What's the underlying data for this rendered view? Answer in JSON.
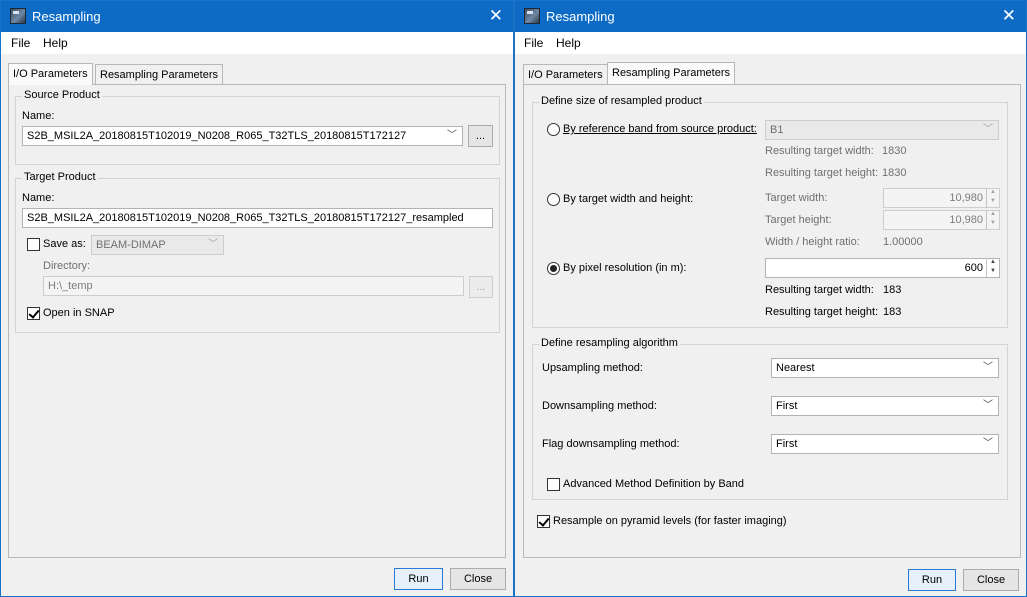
{
  "window_left": {
    "title": "Resampling",
    "menu": {
      "file": "File",
      "help": "Help"
    },
    "tabs": {
      "io": "I/O Parameters",
      "resampling": "Resampling Parameters"
    },
    "source": {
      "legend": "Source Product",
      "name_label": "Name:",
      "name_value": "S2B_MSIL2A_20180815T102019_N0208_R065_T32TLS_20180815T172127",
      "browse": "..."
    },
    "target": {
      "legend": "Target Product",
      "name_label": "Name:",
      "name_value": "S2B_MSIL2A_20180815T102019_N0208_R065_T32TLS_20180815T172127_resampled",
      "save_as_label": "Save as:",
      "save_as_checked": false,
      "format_value": "BEAM-DIMAP",
      "directory_label": "Directory:",
      "directory_value": "H:\\_temp",
      "browse": "...",
      "open_in_snap_label": "Open in SNAP",
      "open_in_snap_checked": true
    },
    "buttons": {
      "run": "Run",
      "close": "Close"
    }
  },
  "window_right": {
    "title": "Resampling",
    "menu": {
      "file": "File",
      "help": "Help"
    },
    "tabs": {
      "io": "I/O Parameters",
      "resampling": "Resampling Parameters"
    },
    "size_group": {
      "legend": "Define size of resampled product",
      "by_reference": {
        "label": "By reference band from source product:",
        "selected": false,
        "band_value": "B1",
        "result_width_label": "Resulting target width:",
        "result_width_value": "1830",
        "result_height_label": "Resulting target height:",
        "result_height_value": "1830"
      },
      "by_width_height": {
        "label": "By target width and height:",
        "selected": false,
        "target_width_label": "Target width:",
        "target_width_value": "10,980",
        "target_height_label": "Target height:",
        "target_height_value": "10,980",
        "ratio_label": "Width / height ratio:",
        "ratio_value": "1.00000"
      },
      "by_pixel_resolution": {
        "label": "By pixel resolution (in m):",
        "selected": true,
        "resolution_value": "600",
        "result_width_label": "Resulting target width:",
        "result_width_value": "183",
        "result_height_label": "Resulting target height:",
        "result_height_value": "183"
      }
    },
    "algorithm_group": {
      "legend": "Define resampling algorithm",
      "upsampling_label": "Upsampling method:",
      "upsampling_value": "Nearest",
      "downsampling_label": "Downsampling method:",
      "downsampling_value": "First",
      "flag_downsampling_label": "Flag downsampling method:",
      "flag_downsampling_value": "First",
      "advanced_label": "Advanced Method Definition by Band",
      "advanced_checked": false
    },
    "pyramid": {
      "label": "Resample on pyramid levels (for faster imaging)",
      "checked": true
    },
    "buttons": {
      "run": "Run",
      "close": "Close"
    }
  }
}
